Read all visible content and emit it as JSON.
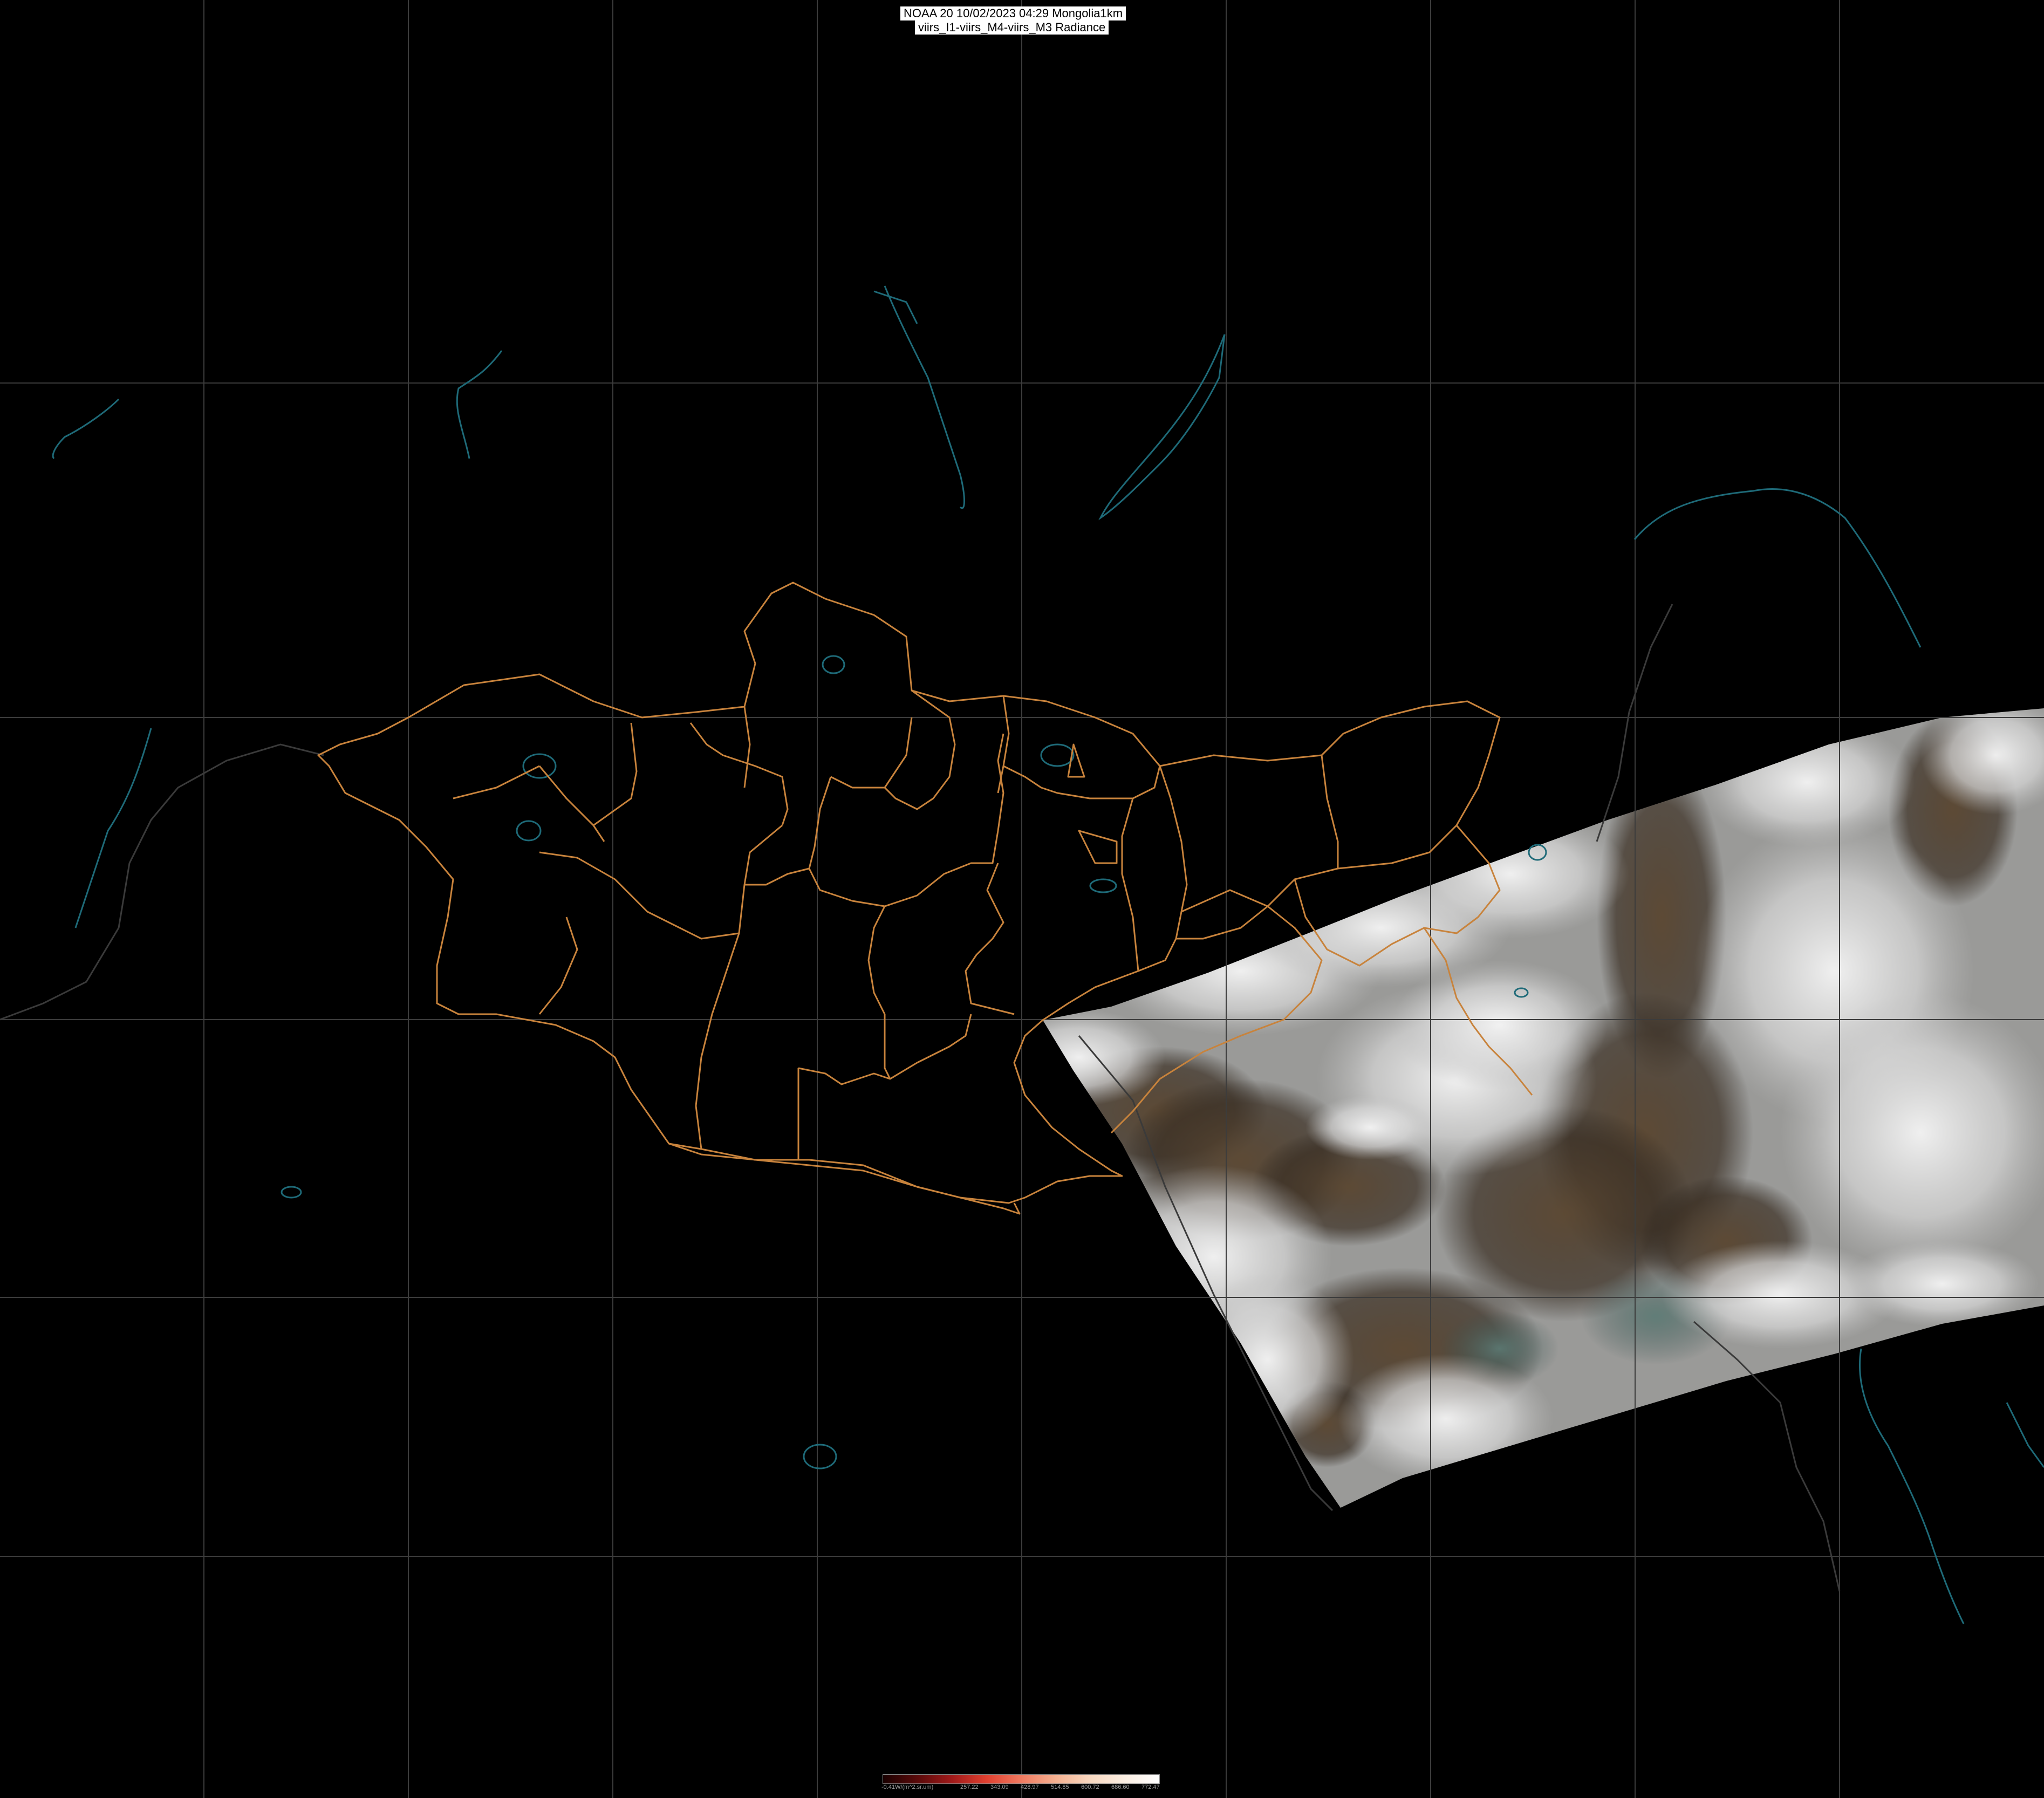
{
  "header": {
    "line1": "NOAA 20 10/02/2023 04:29 Mongolia1km",
    "line2": "viirs_I1-viirs_M4-viirs_M3 Radiance"
  },
  "colors": {
    "background": "#000000",
    "graticule": "#3c3c3c",
    "admin_boundaries": "#c8833c",
    "coast_rivers": "#1e6a78",
    "country_borders": "#3a3a3a"
  },
  "colorbar": {
    "labels": [
      "-0.41W/(m^2.sr.um)",
      "257.22",
      "343.09",
      "428.97",
      "514.85",
      "600.72",
      "686.60",
      "772.47"
    ]
  }
}
